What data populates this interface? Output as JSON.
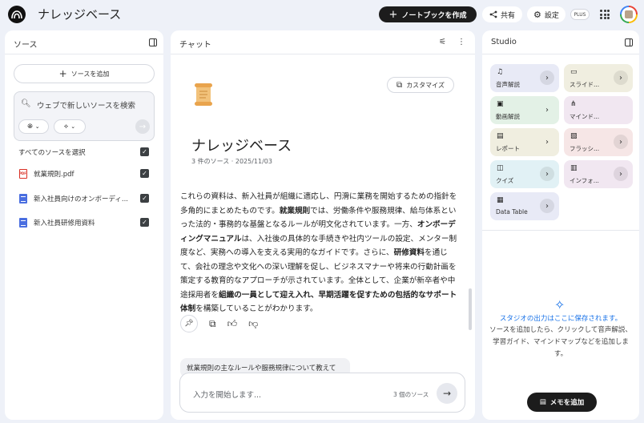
{
  "header": {
    "app_title": "ナレッジベース",
    "create_notebook_label": "ノートブックを作成",
    "share_label": "共有",
    "settings_label": "設定",
    "plan_badge": "PLUS"
  },
  "sources_panel": {
    "title": "ソース",
    "add_source_label": "ソースを追加",
    "search_placeholder": "ウェブで新しいソースを検索",
    "select_all_label": "すべてのソースを選択",
    "items": [
      {
        "label": "就業規則.pdf",
        "icon": "pdf-icon",
        "checked": true
      },
      {
        "label": "新入社員向けのオンボーディ...",
        "icon": "doc-icon",
        "checked": true
      },
      {
        "label": "新入社員研修用資料",
        "icon": "doc-icon",
        "checked": true
      }
    ]
  },
  "chat_panel": {
    "title": "チャット",
    "customize_label": "カスタマイズ",
    "notebook_title": "ナレッジベース",
    "notebook_meta": "3 件のソース · 2025/11/03",
    "summary": {
      "s1": "これらの資料は、新入社員が組織に適応し、円滑に業務を開始するための指針を多角的にまとめたものです。",
      "b1": "就業規則",
      "s2": "では、労働条件や服務規律、給与体系といった法的・事務的な基盤となるルールが明文化されています。一方、",
      "b2": "オンボーディングマニュアル",
      "s3": "は、入社後の具体的な手続きや社内ツールの設定、メンター制度など、実務への導入を支える実用的なガイドです。さらに、",
      "b3": "研修資料",
      "s4": "を通じて、会社の理念や文化への深い理解を促し、ビジネスマナーや将来の行動計画を策定する教育的なアプローチが示されています。全体として、企業が新卒者や中途採用者を",
      "b4": "組織の一員として迎え入れ、早期活躍を促すための包括的なサポート体制",
      "s5": "を構築していることがわかります。"
    },
    "suggestion": "就業規則の主なルールや服務規律について教えて",
    "input_placeholder": "入力を開始します...",
    "source_count": "3 個のソース"
  },
  "studio_panel": {
    "title": "Studio",
    "tiles": [
      {
        "label": "音声解説",
        "icon": "audio-icon",
        "bg": "#e8eaf6"
      },
      {
        "label": "スライド...",
        "icon": "slides-icon",
        "bg": "#f0eee0"
      },
      {
        "label": "動画解説",
        "icon": "video-icon",
        "bg": "#e3f1e6"
      },
      {
        "label": "マインド...",
        "icon": "mindmap-icon",
        "bg": "#f1e7f1"
      },
      {
        "label": "レポート",
        "icon": "report-icon",
        "bg": "#f0eee0"
      },
      {
        "label": "フラッシ...",
        "icon": "flashcard-icon",
        "bg": "#f6e6e6"
      },
      {
        "label": "クイズ",
        "icon": "quiz-icon",
        "bg": "#e1f1f5"
      },
      {
        "label": "インフォ...",
        "icon": "infographic-icon",
        "bg": "#f1e7f1"
      },
      {
        "label": "Data Table",
        "icon": "table-icon",
        "bg": "#e8eaf6"
      }
    ],
    "saved_message": "スタジオの出力はここに保存されます。",
    "hint_message": "ソースを追加したら、クリックして音声解説、学習ガイド、マインドマップなどを追加します。",
    "add_memo_label": "メモを追加"
  }
}
